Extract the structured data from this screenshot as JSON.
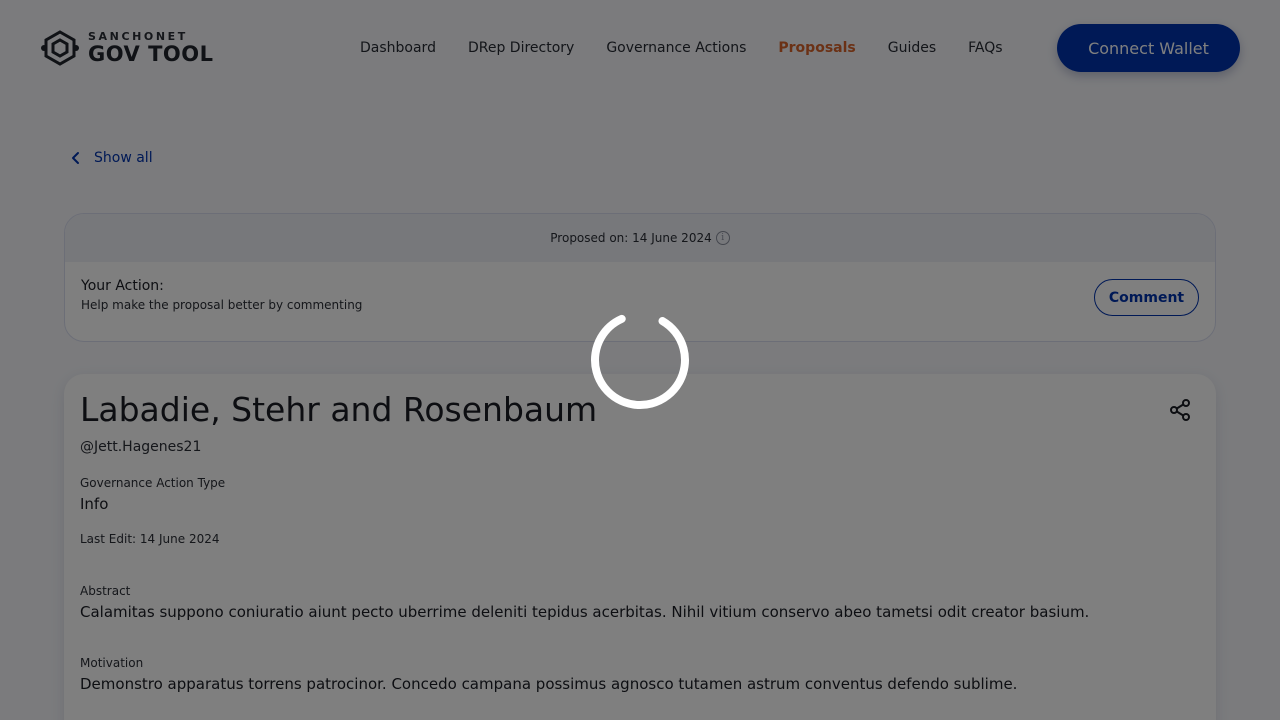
{
  "header": {
    "logo": {
      "top": "SANCHONET",
      "bottom": "GOV TOOL"
    },
    "nav": [
      {
        "label": "Dashboard",
        "active": false
      },
      {
        "label": "DRep Directory",
        "active": false
      },
      {
        "label": "Governance Actions",
        "active": false
      },
      {
        "label": "Proposals",
        "active": true
      },
      {
        "label": "Guides",
        "active": false
      },
      {
        "label": "FAQs",
        "active": false
      }
    ],
    "connect_wallet": "Connect Wallet"
  },
  "back": {
    "label": "Show all",
    "icon": "chevron-left-icon"
  },
  "action_card": {
    "proposed_on": "Proposed on: 14 June 2024",
    "info_icon": "info-icon",
    "your_action_label": "Your Action:",
    "your_action_hint": "Help make the proposal better by commenting",
    "comment_button": "Comment"
  },
  "proposal": {
    "title": "Labadie, Stehr and Rosenbaum",
    "author": "@Jett.Hagenes21",
    "share_icon": "share-icon",
    "type_label": "Governance Action Type",
    "type_value": "Info",
    "last_edit": "Last Edit: 14 June 2024",
    "abstract_label": "Abstract",
    "abstract_value": "Calamitas suppono coniuratio aiunt pecto uberrime deleniti tepidus acerbitas. Nihil vitium conservo abeo tametsi odit creator basium.",
    "motivation_label": "Motivation",
    "motivation_value": "Demonstro apparatus torrens patrocinor. Concedo campana possimus agnosco tutamen astrum conventus defendo sublime."
  },
  "colors": {
    "primary": "#0033ad",
    "active_nav": "#d6632b",
    "overlay": "rgba(0,0,0,0.5)"
  },
  "loading": true
}
